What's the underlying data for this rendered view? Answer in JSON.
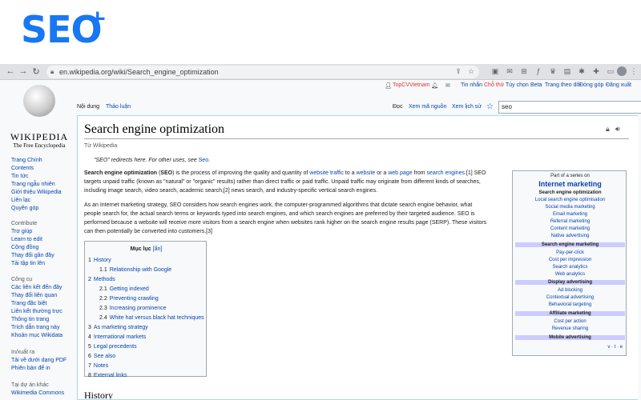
{
  "brand": {
    "text": "SEO",
    "plus": "+"
  },
  "browser": {
    "url": "en.wikipedia.org/wiki/Search_engine_optimization"
  },
  "sidebar": {
    "logo_word": "WIKIPEDIA",
    "logo_sub": "The Free Encyclopedia",
    "main_links": [
      "Trang Chính",
      "Contents",
      "Tin tức",
      "Trang ngẫu nhiên",
      "Giới thiệu Wikipedia",
      "Liên lạc",
      "Quyên góp"
    ],
    "contribute_head": "Contribute",
    "contribute_links": [
      "Trợ giúp",
      "Learn to edit",
      "Cộng đồng",
      "Thay đổi gần đây",
      "Tải tập tin lên"
    ],
    "tools_head": "Công cụ",
    "tools_links": [
      "Các liên kết đến đây",
      "Thay đổi liên quan",
      "Trang đặc biệt",
      "Liên kết thường trực",
      "Thông tin trang",
      "Trích dẫn trang này",
      "Khoản mục Wikidata"
    ],
    "print_head": "In/xuất ra",
    "print_links": [
      "Tải về dưới dạng PDF",
      "Phiên bản để in"
    ],
    "other_head": "Tại dự án khác",
    "other_links": [
      "Wikimedia Commons"
    ]
  },
  "user_links": [
    "TopCVVietnam",
    "Tin nhắn",
    "Chỗ thử",
    "Tùy chọn",
    "Beta",
    "Trang theo dõi",
    "Đóng góp",
    "Đăng xuất"
  ],
  "tabs": {
    "content": "Nội dung",
    "talk": "Thảo luận",
    "read": "Đọc",
    "edit_source": "Xem mã nguồn",
    "history": "Xem lịch sử"
  },
  "search": {
    "value": "seo"
  },
  "article": {
    "title": "Search engine optimization",
    "from": "Từ Wikipedia",
    "hatnote": "\"SEO\" redirects here. For other uses, see ",
    "hatnote_link": "Seo.",
    "p1_l1a": "Search engine optimization",
    "p1_l1b": " (",
    "p1_l1c": "SEO",
    "p1_l1d": ") is the process of improving the quality and quantity of ",
    "p1_l1e": "website traffic",
    "p1_l1f": " to a ",
    "p1_l1g": "website",
    "p1_l1h": " or a ",
    "p1_l1i": "web page",
    "p1_l1j": " from ",
    "p1_l1k": "search engines.",
    "p1_l1l": "[1] SEO",
    "p1_l2": "targets unpaid traffic (known as \"natural\" or \"organic\" results) rather than direct traffic or paid traffic. Unpaid traffic may originate from different kinds of searches,",
    "p1_l3": "including image search, video search, academic search,[2] news search, and industry-specific vertical search engines.",
    "p2_l1": "As an Internet marketing strategy, SEO considers how search engines work, the computer-programmed algorithms that dictate search engine behavior, what",
    "p2_l2": "people search for, the actual search terms or keywords typed into search engines, and which search engines are preferred by their targeted audience. SEO is",
    "p2_l3": "performed because a website will receive more visitors from a search engine when websites rank higher on the search engine results page (SERP). These visitors",
    "p2_l4": "can then potentially be converted into customers.[3]",
    "history_heading": "History"
  },
  "toc": {
    "title": "Mục lục",
    "hide": "[ẩn]",
    "items": [
      {
        "num": "1",
        "label": "History"
      },
      {
        "num": "1.1",
        "label": "Relationship with Google"
      },
      {
        "num": "2",
        "label": "Methods"
      },
      {
        "num": "2.1",
        "label": "Getting indexed"
      },
      {
        "num": "2.2",
        "label": "Preventing crawling"
      },
      {
        "num": "2.3",
        "label": "Increasing prominence"
      },
      {
        "num": "2.4",
        "label": "White hat versus black hat techniques"
      },
      {
        "num": "3",
        "label": "As marketing strategy"
      },
      {
        "num": "4",
        "label": "International markets"
      },
      {
        "num": "5",
        "label": "Legal precedents"
      },
      {
        "num": "6",
        "label": "See also"
      },
      {
        "num": "7",
        "label": "Notes"
      },
      {
        "num": "8",
        "label": "External links"
      }
    ]
  },
  "infobox": {
    "part_of": "Part of a series on",
    "title": "Internet marketing",
    "current": "Search engine optimization",
    "group1": [
      "Local search engine optimisation",
      "Social media marketing",
      "Email marketing",
      "Referral marketing",
      "Content marketing",
      "Native advertising"
    ],
    "head_sem": "Search engine marketing",
    "group2": [
      "Pay-per-click",
      "Cost per impression",
      "Search analytics",
      "Web analytics"
    ],
    "head_display": "Display advertising",
    "group3": [
      "Ad blocking",
      "Contextual advertising",
      "Behavioral targeting"
    ],
    "head_affiliate": "Affiliate marketing",
    "group4": [
      "Cost per action",
      "Revenue sharing"
    ],
    "head_mobile": "Mobile advertising",
    "vte": "v · t · e"
  },
  "colors": {
    "brand": "#1877f2",
    "link": "#0645ad",
    "red_link": "#d33"
  }
}
